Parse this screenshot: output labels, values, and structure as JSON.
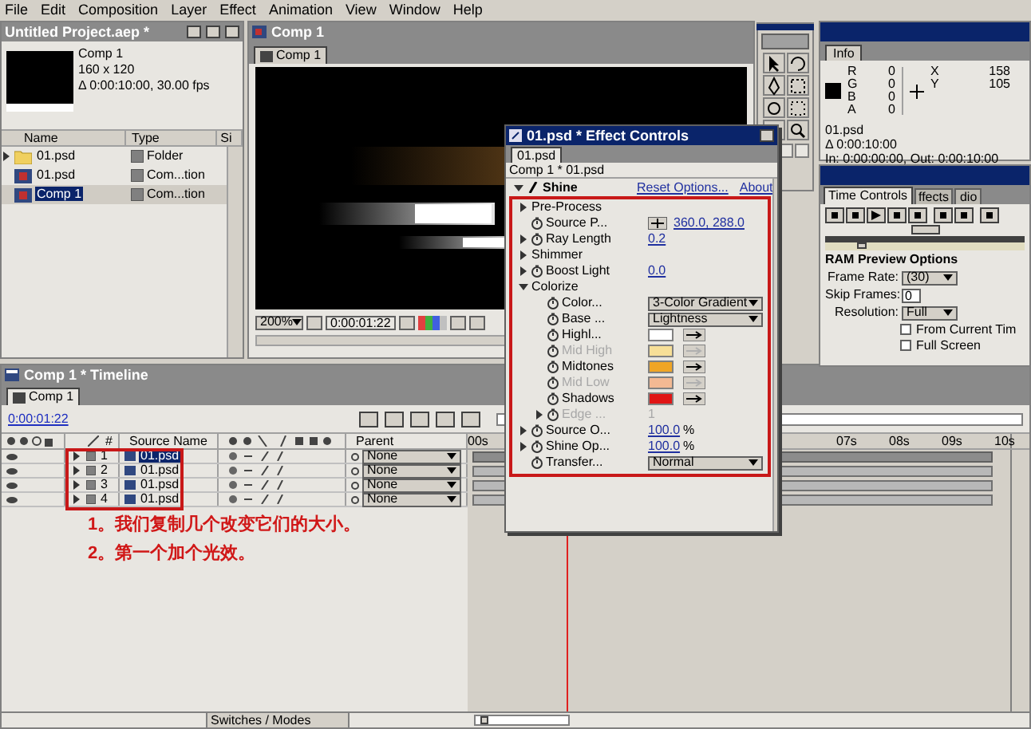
{
  "menu": [
    "File",
    "Edit",
    "Composition",
    "Layer",
    "Effect",
    "Animation",
    "View",
    "Window",
    "Help"
  ],
  "project": {
    "title": "Untitled Project.aep *",
    "thumb_info": [
      "Comp 1",
      "160 x 120",
      "Δ 0:00:10:00, 30.00 fps"
    ],
    "columns": [
      "Name",
      "Type",
      "Si"
    ],
    "items": [
      {
        "kind": "folder",
        "name": "01.psd",
        "type": "Folder",
        "selected": false
      },
      {
        "kind": "composition",
        "name": "01.psd",
        "type": "Com...tion",
        "selected": false
      },
      {
        "kind": "composition",
        "name": "Comp 1",
        "type": "Com...tion",
        "selected": true
      }
    ]
  },
  "comp_viewer": {
    "title": "Comp 1",
    "tab": "Comp 1",
    "zoom": "200%",
    "time": "0:00:01:22"
  },
  "info": {
    "title": "Info",
    "channels": [
      {
        "label": "R",
        "value": "0"
      },
      {
        "label": "G",
        "value": "0"
      },
      {
        "label": "B",
        "value": "0"
      },
      {
        "label": "A",
        "value": "0"
      }
    ],
    "coords": [
      {
        "label": "X",
        "value": "158"
      },
      {
        "label": "Y",
        "value": "105"
      }
    ],
    "lines": [
      "01.psd",
      "Δ 0:00:10:00",
      "In: 0:00:00:00, Out: 0:00:10:00"
    ]
  },
  "time_controls": {
    "tabs": [
      {
        "label": "Time Controls",
        "selected": true
      },
      {
        "label": "ffects",
        "selected": false
      },
      {
        "label": "dio",
        "selected": false
      }
    ],
    "heading": "RAM Preview Options",
    "fields": [
      {
        "kind": "dropdown",
        "label": "Frame Rate:",
        "value": "(30)"
      },
      {
        "kind": "input",
        "label": "Skip Frames:",
        "value": "0"
      },
      {
        "kind": "dropdown",
        "label": "Resolution:",
        "value": "Full"
      }
    ],
    "shuttle": {
      "level": 0.18
    },
    "options": [
      {
        "label": "From Current Tim",
        "checked": false
      },
      {
        "label": "Full Screen",
        "checked": false
      }
    ]
  },
  "effect_controls": {
    "title": "01.psd * Effect Controls",
    "tab": "01.psd",
    "subtitle": "Comp 1 * 01.psd",
    "effect": {
      "name": "Shine",
      "reset": "Reset Options...",
      "about": "About"
    },
    "params": [
      {
        "kind": "group",
        "label": "Pre-Process",
        "expanded": false
      },
      {
        "kind": "point",
        "label": "Source P...",
        "value": "360.0, 288.0"
      },
      {
        "kind": "value",
        "label": "Ray Length",
        "value": "0.2",
        "expanded": false
      },
      {
        "kind": "group",
        "label": "Shimmer",
        "expanded": false
      },
      {
        "kind": "value",
        "label": "Boost Light",
        "value": "0.0",
        "expanded": false
      },
      {
        "kind": "group",
        "label": "Colorize",
        "expanded": true,
        "children": [
          {
            "kind": "dropdown",
            "label": "Color...",
            "value": "3-Color Gradient"
          },
          {
            "kind": "dropdown",
            "label": "Base ...",
            "value": "Lightness"
          },
          {
            "kind": "color",
            "label": "Highl...",
            "color": "#ffffff",
            "disabled": false
          },
          {
            "kind": "color",
            "label": "Mid High",
            "color": "#f7df97",
            "disabled": true
          },
          {
            "kind": "color",
            "label": "Midtones",
            "color": "#f0a525",
            "disabled": false
          },
          {
            "kind": "color",
            "label": "Mid Low",
            "color": "#f3b993",
            "disabled": true
          },
          {
            "kind": "color",
            "label": "Shadows",
            "color": "#e01515",
            "disabled": false
          },
          {
            "kind": "value",
            "label": "Edge ...",
            "value": "1",
            "expanded": false,
            "disabled": true
          }
        ]
      },
      {
        "kind": "value",
        "label": "Source O...",
        "value": "100.0",
        "unit": "%",
        "expanded": false
      },
      {
        "kind": "value",
        "label": "Shine Op...",
        "value": "100.0",
        "unit": "%",
        "expanded": false
      },
      {
        "kind": "dropdown",
        "label": "Transfer...",
        "value": "Normal"
      }
    ]
  },
  "timeline": {
    "title": "Comp 1 * Timeline",
    "tab": "Comp 1",
    "time": "0:00:01:22",
    "columns": [
      "#",
      "Source Name",
      "Parent"
    ],
    "ruler": [
      "00s",
      "07s",
      "08s",
      "09s",
      "10s"
    ],
    "layers": [
      {
        "number": "1",
        "name": "01.psd",
        "parent": "None",
        "selected": true
      },
      {
        "number": "2",
        "name": "01.psd",
        "parent": "None",
        "selected": false
      },
      {
        "number": "3",
        "name": "01.psd",
        "parent": "None",
        "selected": false
      },
      {
        "number": "4",
        "name": "01.psd",
        "parent": "None",
        "selected": false
      }
    ],
    "annotations": [
      "1。我们复制几个改变它们的大小。",
      "2。第一个加个光效。"
    ],
    "zoom": {
      "level": 0.05
    },
    "switches_label": "Switches / Modes"
  }
}
